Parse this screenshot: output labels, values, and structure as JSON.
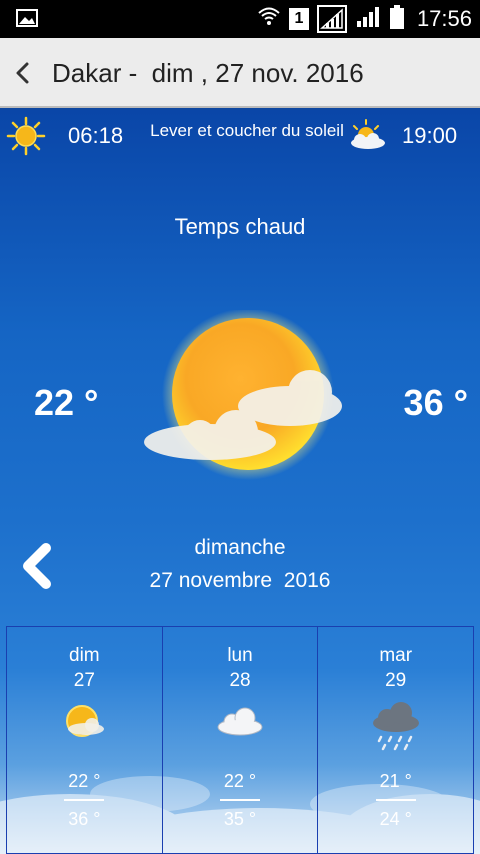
{
  "status_bar": {
    "time": "17:56",
    "sim_slot": "1",
    "icons": [
      "image-icon",
      "wifi-icon",
      "signal-icon",
      "signal-icon",
      "battery-icon"
    ]
  },
  "app_bar": {
    "title": "Dakar -  dim , 27 nov. 2016",
    "back_icon": "back-arrow-icon"
  },
  "sun": {
    "sunrise": "06:18",
    "sunset": "19:00",
    "caption": "Lever et coucher du soleil",
    "sunrise_icon": "sun-icon",
    "sunset_icon": "sun-cloud-icon"
  },
  "current": {
    "condition": "Temps chaud",
    "temp_min": "22 °",
    "temp_max": "36 °",
    "icon": "sun-cloud-icon",
    "day_name": "dimanche",
    "date": "27 novembre  2016"
  },
  "forecast": [
    {
      "day": "dim",
      "date": "27",
      "hi": "22 °",
      "lo": "36 °",
      "icon": "sun-cloud-icon"
    },
    {
      "day": "lun",
      "date": "28",
      "hi": "22 °",
      "lo": "35 °",
      "icon": "cloud-icon"
    },
    {
      "day": "mar",
      "date": "29",
      "hi": "21 °",
      "lo": "24 °",
      "icon": "rain-cloud-icon"
    }
  ],
  "colors": {
    "sky_top": "#0a46a8",
    "sky_bottom": "#c9def3",
    "app_bar": "#ececec",
    "sun": "#f5b81c",
    "grid_line": "#1a3fb0"
  }
}
